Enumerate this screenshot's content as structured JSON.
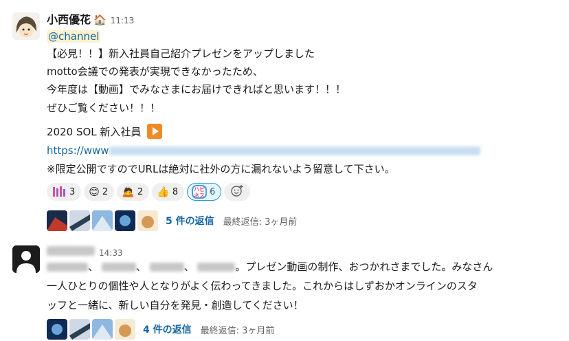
{
  "message1": {
    "author": "小西優花",
    "status_emoji": "house-emoji",
    "time": "11:13",
    "mention": "@channel",
    "lines": [
      "【必見！！】新入社員自己紹介プレゼンをアップしました",
      "motto会議での発表が実現できなかったため、",
      "今年度は【動画】でみなさまにお届けできればと思います！！！",
      "ぜひご覧ください！！！"
    ],
    "video_title": "2020 SOL 新入社員",
    "link_prefix": "https://www",
    "notice": "※限定公開ですのでURLは絶対に社外の方に漏れないよう留意して下さい。",
    "reactions": [
      {
        "emoji": "pin-emoji",
        "count": "3"
      },
      {
        "emoji": "😊",
        "count": "2"
      },
      {
        "emoji": "🙇",
        "count": "2"
      },
      {
        "emoji": "👍",
        "count": "8"
      },
      {
        "emoji": "ハピネス",
        "count": "6"
      }
    ],
    "thread": {
      "replies": "5 件の返信",
      "last_reply": "最終返信: 3ヶ月前"
    }
  },
  "message2": {
    "time": "14:33",
    "body_line1_suffix": "。プレゼン動画の制作、おつかれさまでした。みなさん",
    "body_line2": "一人ひとりの個性や人となりがよく伝わってきました。これからはしずおかオンラインのスタ",
    "body_line3": "ッフと一緒に、新しい自分を発見・創造してください！",
    "thread": {
      "replies": "4 件の返信",
      "last_reply": "最終返信: 3ヶ月前"
    }
  },
  "colors": {
    "link": "#1264a3",
    "mention_bg": "#fdf1cc",
    "reaction_active_border": "#1d9bd1"
  }
}
